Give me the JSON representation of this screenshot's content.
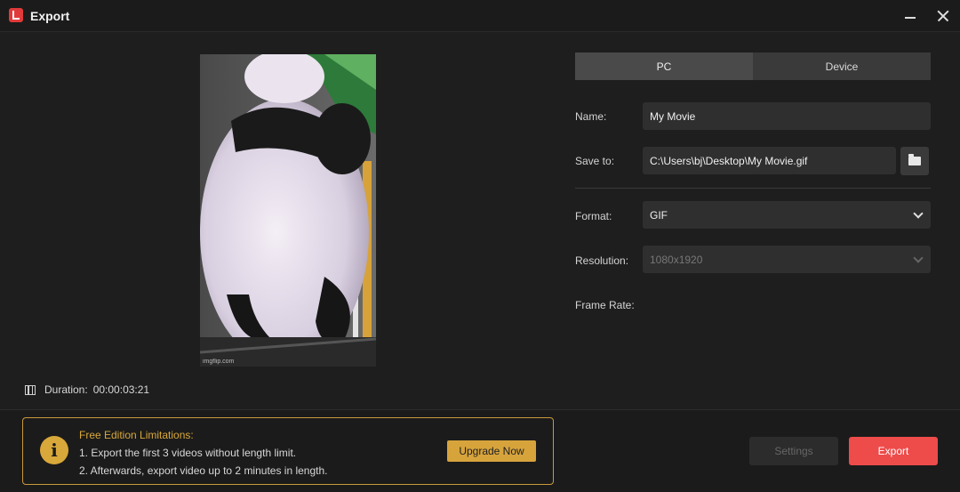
{
  "window": {
    "title": "Export",
    "app_icon": "filmora-logo-icon",
    "controls": [
      "minimize-icon",
      "close-icon"
    ]
  },
  "preview": {
    "watermark": "imgflip.com",
    "duration_label": "Duration:",
    "duration_value": "00:00:03:21",
    "duration_icon": "film-icon"
  },
  "tabs": [
    {
      "label": "PC",
      "active": true
    },
    {
      "label": "Device",
      "active": false
    }
  ],
  "form": {
    "name_label": "Name:",
    "name_value": "My Movie",
    "save_label": "Save to:",
    "save_value": "C:\\Users\\bj\\Desktop\\My Movie.gif",
    "format_label": "Format:",
    "format_value": "GIF",
    "resolution_label": "Resolution:",
    "resolution_value": "1080x1920",
    "framerate_label": "Frame Rate:"
  },
  "limitations": {
    "title": "Free Edition Limitations:",
    "line1": "1. Export the first 3 videos without length limit.",
    "line2": "2. Afterwards, export video up to 2 minutes in length.",
    "upgrade_label": "Upgrade Now",
    "icon": "info-icon"
  },
  "actions": {
    "settings_label": "Settings",
    "export_label": "Export"
  },
  "colors": {
    "accent_red": "#ee4b4b",
    "accent_gold": "#d7a43c",
    "background": "#1e1e1e"
  }
}
